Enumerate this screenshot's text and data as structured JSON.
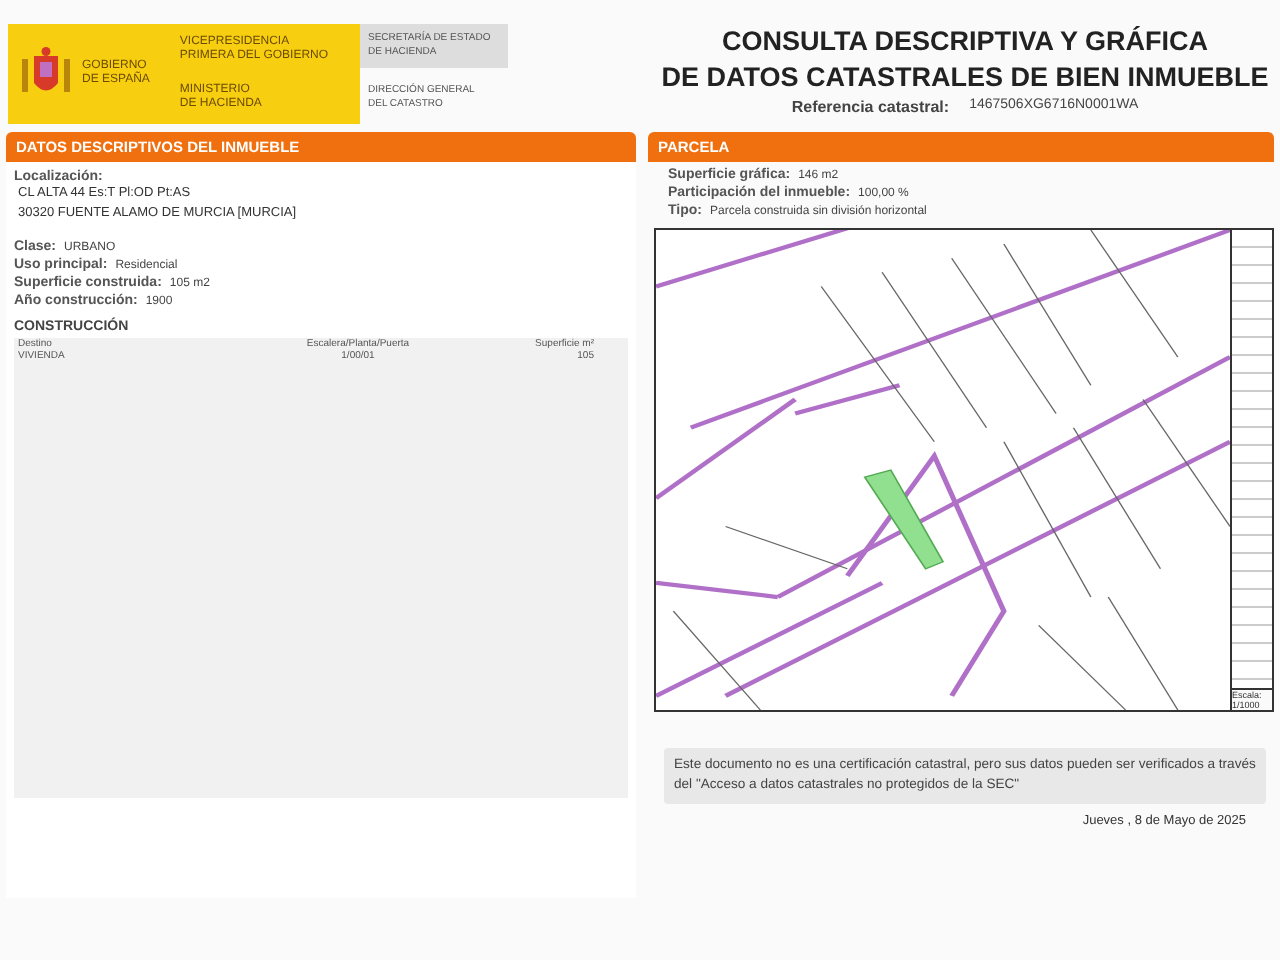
{
  "header": {
    "logo_text": [
      "GOBIERNO",
      "DE ESPAÑA"
    ],
    "ministry_top": [
      "VICEPRESIDENCIA",
      "PRIMERA DEL GOBIERNO"
    ],
    "ministry_bottom": [
      "MINISTERIO",
      "DE HACIENDA"
    ],
    "secretary": [
      "SECRETARÍA DE ESTADO",
      "DE HACIENDA"
    ],
    "direction": [
      "DIRECCIÓN GENERAL",
      "DEL CATASTRO"
    ],
    "title": [
      "CONSULTA DESCRIPTIVA Y GRÁFICA",
      "DE DATOS CATASTRALES DE BIEN INMUEBLE"
    ],
    "reference_label": "Referencia catastral:",
    "reference_value": "1467506XG6716N0001WA"
  },
  "inmueble": {
    "heading": "DATOS DESCRIPTIVOS DEL INMUEBLE",
    "location_label": "Localización:",
    "location_lines": [
      "CL ALTA 44 Es:T Pl:OD Pt:AS",
      "30320 FUENTE ALAMO DE MURCIA [MURCIA]"
    ],
    "fields": [
      {
        "label": "Clase:",
        "value": "URBANO"
      },
      {
        "label": "Uso principal:",
        "value": "Residencial"
      },
      {
        "label": "Superficie construida:",
        "value": "105 m2"
      },
      {
        "label": "Año construcción:",
        "value": "1900"
      }
    ],
    "construction_heading": "CONSTRUCCIÓN",
    "table": {
      "columns": [
        "Destino",
        "Escalera/Planta/Puerta",
        "Superficie m²"
      ],
      "rows": [
        [
          "VIVIENDA",
          "1/00/01",
          "105"
        ]
      ]
    }
  },
  "parcela": {
    "heading": "PARCELA",
    "fields": [
      {
        "label": "Superficie gráfica:",
        "value": "146 m2"
      },
      {
        "label": "Participación del inmueble:",
        "value": "100,00 %"
      },
      {
        "label": "Tipo:",
        "value": "Parcela construida sin división horizontal"
      }
    ],
    "scale_label": "Escala:",
    "scale_value": "1/1000"
  },
  "note": "Este documento no es una certificación catastral, pero sus datos pueden ser verificados a través del \"Acceso a datos catastrales no protegidos de la SEC\"",
  "date": "Jueves , 8 de Mayo de 2025"
}
